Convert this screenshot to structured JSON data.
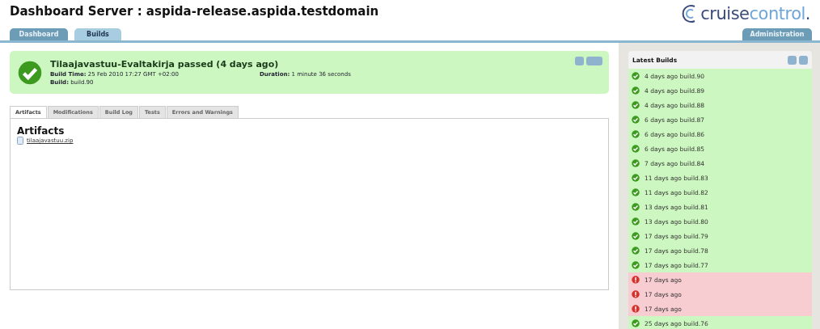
{
  "header": {
    "title": "Dashboard Server : aspida-release.aspida.testdomain",
    "logo": {
      "part1": "cruise",
      "part2": "control",
      "dot": "."
    }
  },
  "nav_tabs": [
    {
      "label": "Dashboard",
      "selected": false
    },
    {
      "label": "Builds",
      "selected": true
    }
  ],
  "admin_tab": {
    "label": "Administration",
    "selected": false
  },
  "build_summary": {
    "passed": true,
    "title": "Tilaajavastuu-Evaltakirja passed (4 days ago)",
    "build_time_label": "Build Time:",
    "build_time": "25 Feb 2010 17:27 GMT +02:00",
    "duration_label": "Duration:",
    "duration": "1 minute 36 seconds",
    "build_label": "Build:",
    "build": "build.90"
  },
  "detail_tabs": [
    {
      "label": "Artifacts",
      "selected": true
    },
    {
      "label": "Modifications",
      "selected": false
    },
    {
      "label": "Build Log",
      "selected": false
    },
    {
      "label": "Tests",
      "selected": false
    },
    {
      "label": "Errors and Warnings",
      "selected": false
    }
  ],
  "artifacts": {
    "heading": "Artifacts",
    "files": [
      "tilaajavastuu.zip"
    ]
  },
  "latest_builds": {
    "title": "Latest Builds",
    "items": [
      {
        "passed": true,
        "label": "4 days ago build.90"
      },
      {
        "passed": true,
        "label": "4 days ago build.89"
      },
      {
        "passed": true,
        "label": "4 days ago build.88"
      },
      {
        "passed": true,
        "label": "6 days ago build.87"
      },
      {
        "passed": true,
        "label": "6 days ago build.86"
      },
      {
        "passed": true,
        "label": "6 days ago build.85"
      },
      {
        "passed": true,
        "label": "7 days ago build.84"
      },
      {
        "passed": true,
        "label": "11 days ago build.83"
      },
      {
        "passed": true,
        "label": "11 days ago build.82"
      },
      {
        "passed": true,
        "label": "13 days ago build.81"
      },
      {
        "passed": true,
        "label": "13 days ago build.80"
      },
      {
        "passed": true,
        "label": "17 days ago build.79"
      },
      {
        "passed": true,
        "label": "17 days ago build.78"
      },
      {
        "passed": true,
        "label": "17 days ago build.77"
      },
      {
        "passed": false,
        "label": "17 days ago"
      },
      {
        "passed": false,
        "label": "17 days ago"
      },
      {
        "passed": false,
        "label": "17 days ago"
      },
      {
        "passed": true,
        "label": "25 days ago build.76"
      }
    ]
  }
}
